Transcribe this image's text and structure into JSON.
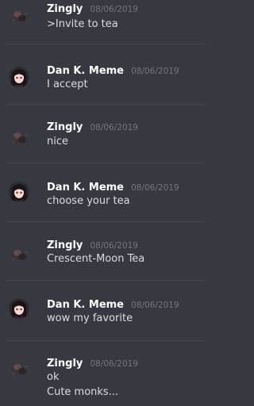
{
  "messages": [
    {
      "author": "Zingly",
      "time": "08/06/2019",
      "avatar": "dark-creature-avatar",
      "lines": [
        ">Invite to tea"
      ]
    },
    {
      "author": "Dan K. Meme",
      "time": "08/06/2019",
      "avatar": "anime-girl-avatar",
      "lines": [
        "I accept"
      ]
    },
    {
      "author": "Zingly",
      "time": "08/06/2019",
      "avatar": "dark-creature-avatar",
      "lines": [
        "nice"
      ]
    },
    {
      "author": "Dan K. Meme",
      "time": "08/06/2019",
      "avatar": "anime-girl-avatar",
      "lines": [
        "choose your tea"
      ]
    },
    {
      "author": "Zingly",
      "time": "08/06/2019",
      "avatar": "dark-creature-avatar",
      "lines": [
        "Crescent-Moon Tea"
      ]
    },
    {
      "author": "Dan K. Meme",
      "time": "08/06/2019",
      "avatar": "anime-girl-avatar",
      "lines": [
        "wow my favorite"
      ]
    },
    {
      "author": "Zingly",
      "time": "08/06/2019",
      "avatar": "dark-creature-avatar",
      "lines": [
        "ok",
        "Cute monks..."
      ]
    }
  ],
  "colors": {
    "background": "#36393f",
    "author": "#ffffff",
    "timestamp": "#72767d",
    "text": "#dcddde"
  }
}
